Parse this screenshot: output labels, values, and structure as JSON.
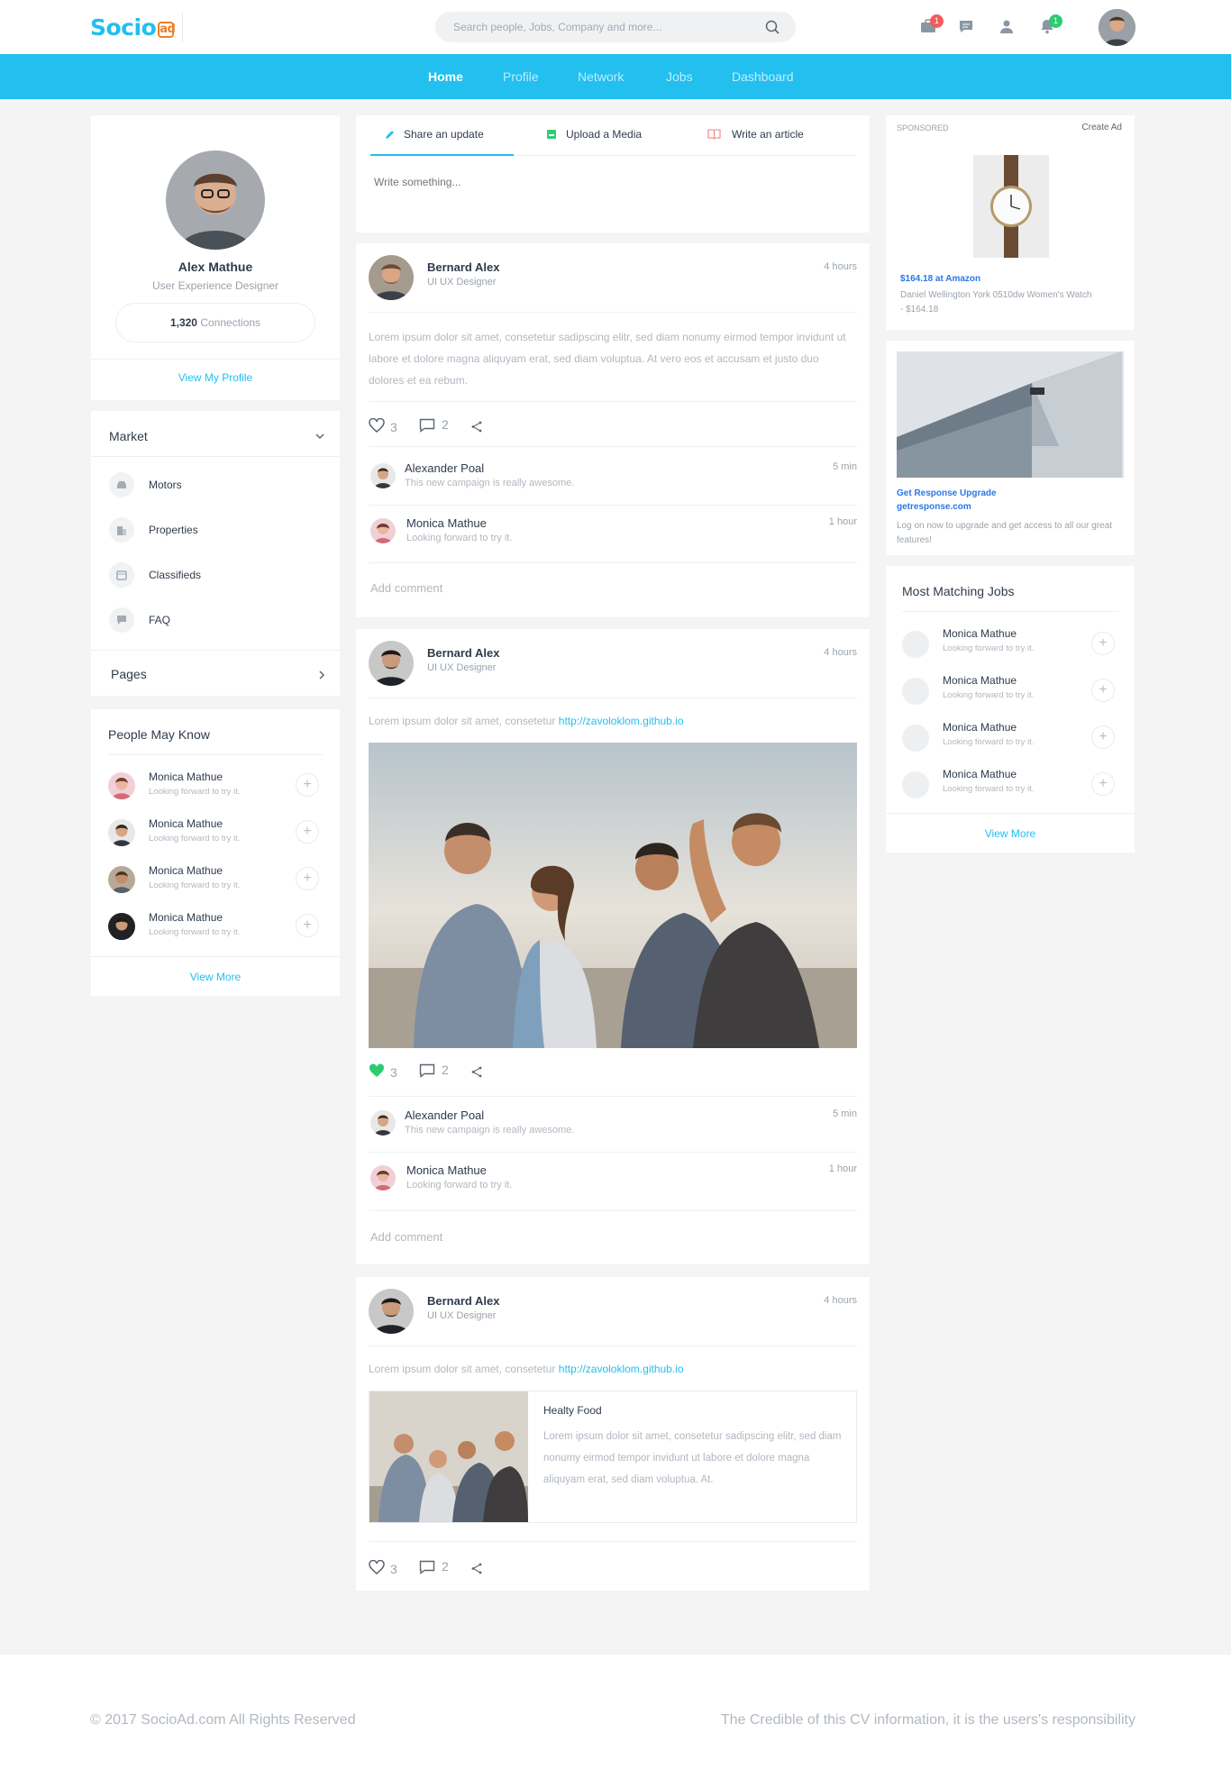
{
  "brand": {
    "name": "Socio",
    "mark": "ad"
  },
  "search": {
    "placeholder": "Search people, Jobs, Company and more..."
  },
  "topbar": {
    "badges": {
      "briefcase": "1",
      "bell": "1"
    }
  },
  "nav": [
    "Home",
    "Profile",
    "Network",
    "Jobs",
    "Dashboard"
  ],
  "profile": {
    "name": "Alex Mathue",
    "title": "User Experience Designer",
    "connections": "1,320",
    "connections_label": "Connections",
    "view_link": "View My Profile"
  },
  "market": {
    "title": "Market",
    "items": [
      "Motors",
      "Properties",
      "Classifieds",
      "FAQ"
    ]
  },
  "pages": {
    "title": "Pages"
  },
  "people": {
    "title": "People May Know",
    "items": [
      {
        "name": "Monica Mathue",
        "sub": "Looking forward to try it."
      },
      {
        "name": "Monica Mathue",
        "sub": "Looking forward to try it."
      },
      {
        "name": "Monica Mathue",
        "sub": "Looking forward to try it."
      },
      {
        "name": "Monica Mathue",
        "sub": "Looking forward to try it."
      }
    ],
    "more": "View More"
  },
  "composer": {
    "tabs": [
      "Share an update",
      "Upload a Media",
      "Write an article"
    ],
    "placeholder": "Write something..."
  },
  "posts": [
    {
      "author": "Bernard Alex",
      "role": "UI UX Designer",
      "time": "4 hours",
      "text": "Lorem ipsum dolor sit amet, consetetur sadipscing elitr, sed diam nonumy eirmod tempor invidunt ut labore et dolore magna aliquyam erat, sed diam voluptua. At vero eos et accusam et justo duo dolores et ea rebum.",
      "likes": "3",
      "comments": "2",
      "replies": [
        {
          "name": "Alexander Poal",
          "text": "This new campaign is really awesome.",
          "time": "5 min"
        },
        {
          "name": "Monica Mathue",
          "text": "Looking forward to try it.",
          "time": "1 hour"
        }
      ],
      "add_comment": "Add comment"
    },
    {
      "author": "Bernard Alex",
      "role": "UI UX Designer",
      "time": "4 hours",
      "text": "Lorem ipsum dolor sit amet, consetetur",
      "link": "http://zavoloklom.github.io",
      "likes": "3",
      "comments": "2",
      "replies": [
        {
          "name": "Alexander Poal",
          "text": "This new campaign is really awesome.",
          "time": "5 min"
        },
        {
          "name": "Monica Mathue",
          "text": "Looking forward to try it.",
          "time": "1 hour"
        }
      ],
      "add_comment": "Add comment"
    },
    {
      "author": "Bernard Alex",
      "role": "UI UX Designer",
      "time": "4 hours",
      "text": "Lorem ipsum dolor sit amet, consetetur",
      "link": "http://zavoloklom.github.io",
      "embed": {
        "title": "Healty Food",
        "text": "Lorem ipsum dolor sit amet, consetetur sadipscing elitr, sed diam nonumy eirmod tempor invidunt ut labore et dolore magna aliquyam erat, sed diam voluptua. At."
      },
      "likes": "3",
      "comments": "2"
    }
  ],
  "sponsored": {
    "label": "SPONSORED",
    "create": "Create Ad",
    "price": "$164.18 at Amazon",
    "desc": "Daniel Wellington York 0510dw Women's Watch - $164.18"
  },
  "promo": {
    "title": "Get Response Upgrade",
    "url": "getresponse.com",
    "text": "Log on now to upgrade and get access to all our great features!"
  },
  "jobs": {
    "title": "Most Matching Jobs",
    "items": [
      {
        "name": "Monica Mathue",
        "sub": "Looking forward to try it."
      },
      {
        "name": "Monica Mathue",
        "sub": "Looking forward to try it."
      },
      {
        "name": "Monica Mathue",
        "sub": "Looking forward to try it."
      },
      {
        "name": "Monica Mathue",
        "sub": "Looking forward to try it."
      }
    ],
    "more": "View More"
  },
  "footer": {
    "copyright": "© 2017 SocioAd.com All Rights Reserved",
    "disclaimer": "The Credible of this CV information, it is the users's responsibility"
  },
  "colors": {
    "accent": "#22bfef",
    "like_active": "#2ecc71",
    "badge_red": "#f25c5c",
    "badge_green": "#2ecc71",
    "brand_orange": "#f07e22"
  }
}
